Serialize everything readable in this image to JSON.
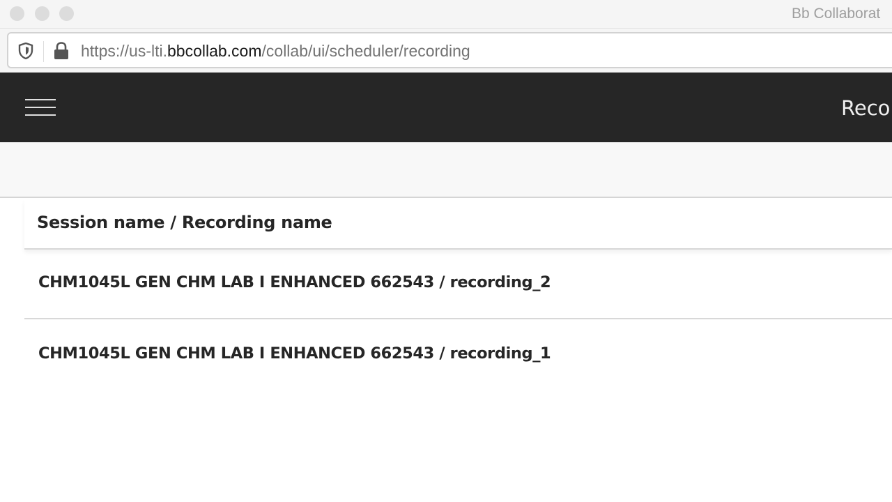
{
  "browser": {
    "window_title": "Bb Collaborat",
    "url_prefix": "https://us-lti.",
    "url_domain": "bbcollab.com",
    "url_path": "/collab/ui/scheduler/recording",
    "icons": {
      "shield": "tracking-protection-shield-icon",
      "lock": "secure-lock-icon"
    }
  },
  "app": {
    "menu_icon": "hamburger-menu-icon",
    "header_title": "Recor"
  },
  "table": {
    "column_header": "Session name / Recording name",
    "rows": [
      {
        "name": "CHM1045L GEN CHM LAB I ENHANCED 662543 / recording_2"
      },
      {
        "name": "CHM1045L GEN CHM LAB I ENHANCED 662543 / recording_1"
      }
    ]
  }
}
